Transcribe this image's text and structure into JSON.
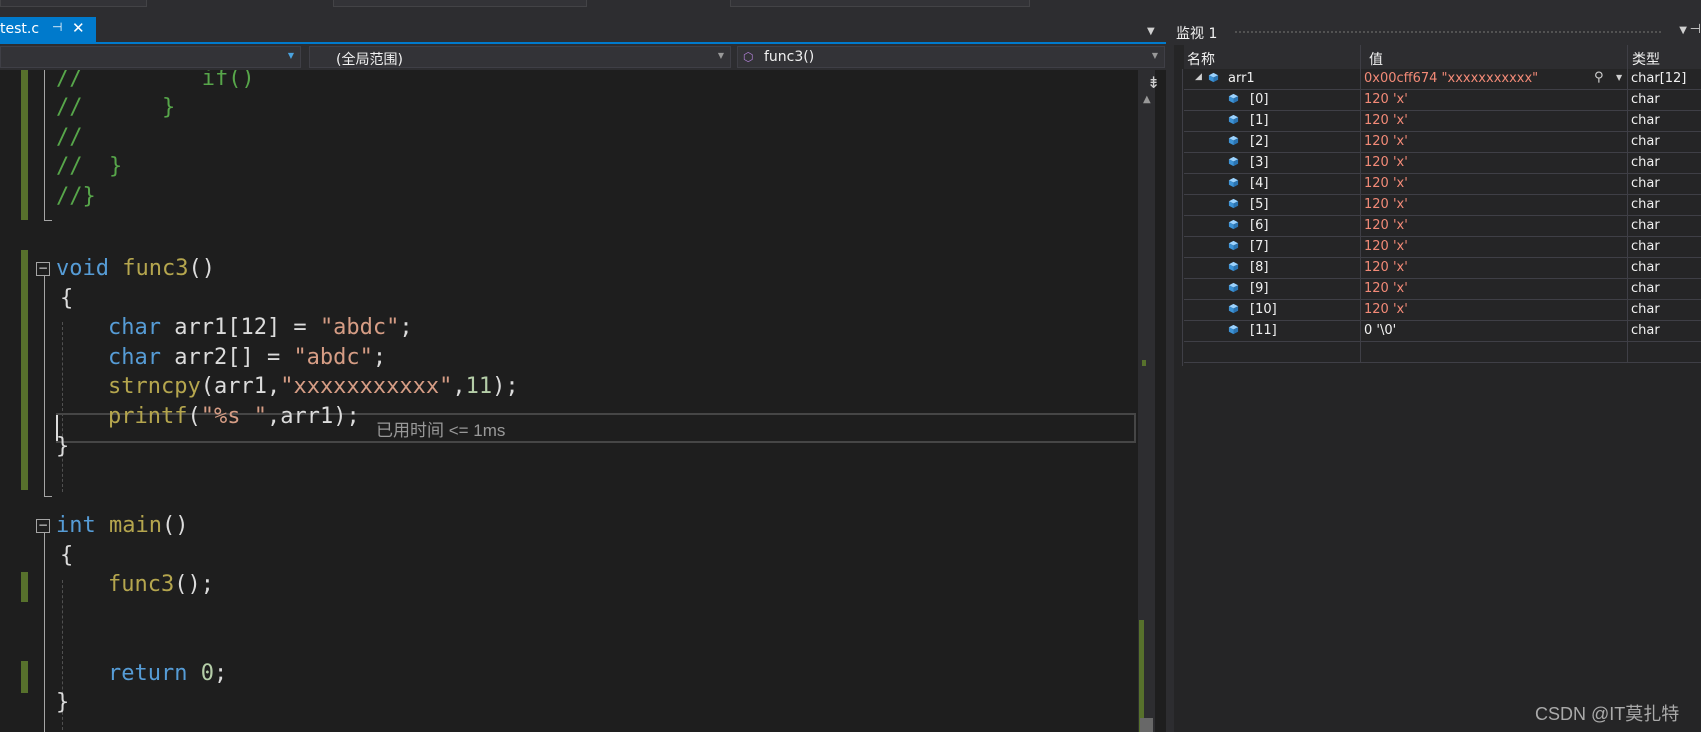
{
  "editor": {
    "tab": {
      "filename": "test.c",
      "pin_icon": "pin-icon",
      "close_icon": "close-icon"
    },
    "nav": {
      "scope": "(全局范围)",
      "function": "func3()"
    },
    "perf_tip": "已用时间 <= 1ms"
  },
  "code_lines": {
    "l1_comment": "//         if()",
    "l2_comment": "//      }",
    "l3_comment": "//",
    "l4_comment": "//  }",
    "l5_comment": "//}",
    "f_void": "void",
    "f_name": "func3",
    "f_parens": "()",
    "brace_open": "{",
    "brace_close": "}",
    "l8_type": "char",
    "l8_rest": " arr1[12] = ",
    "l8_str": "\"abdc\"",
    "l8_end": ";",
    "l9_type": "char",
    "l9_rest": " arr2[] = ",
    "l9_str": "\"abdc\"",
    "l9_end": ";",
    "l10_fn": "strncpy",
    "l10_a": "(arr1,",
    "l10_str": "\"xxxxxxxxxxx\"",
    "l10_b": ",",
    "l10_num": "11",
    "l10_end": ");",
    "l11_fn": "printf",
    "l11_a": "(",
    "l11_str": "\"%s \"",
    "l11_end": ",arr1);",
    "m_int": "int",
    "m_name": "main",
    "m_parens": "()",
    "m_call": "func3",
    "m_call_end": "();",
    "m_return": "return",
    "m_zero": "0",
    "m_semi": ";"
  },
  "watch": {
    "title": "监视 1",
    "columns": {
      "name": "名称",
      "value": "值",
      "type": "类型"
    },
    "root": {
      "name": "arr1",
      "value": "0x00cff674 \"xxxxxxxxxxx\"",
      "type": "char[12]"
    },
    "items": [
      {
        "name": "[0]",
        "value": "120 'x'",
        "type": "char"
      },
      {
        "name": "[1]",
        "value": "120 'x'",
        "type": "char"
      },
      {
        "name": "[2]",
        "value": "120 'x'",
        "type": "char"
      },
      {
        "name": "[3]",
        "value": "120 'x'",
        "type": "char"
      },
      {
        "name": "[4]",
        "value": "120 'x'",
        "type": "char"
      },
      {
        "name": "[5]",
        "value": "120 'x'",
        "type": "char"
      },
      {
        "name": "[6]",
        "value": "120 'x'",
        "type": "char"
      },
      {
        "name": "[7]",
        "value": "120 'x'",
        "type": "char"
      },
      {
        "name": "[8]",
        "value": "120 'x'",
        "type": "char"
      },
      {
        "name": "[9]",
        "value": "120 'x'",
        "type": "char"
      },
      {
        "name": "[10]",
        "value": "120 'x'",
        "type": "char"
      },
      {
        "name": "[11]",
        "value": "0 '\\0'",
        "type": "char"
      }
    ]
  },
  "watermark": "CSDN @IT莫扎特",
  "colors": {
    "accent": "#007acc",
    "changed_value": "#f38a77",
    "comment": "#57a64a",
    "keyword": "#569cd6",
    "string": "#d69d85"
  }
}
